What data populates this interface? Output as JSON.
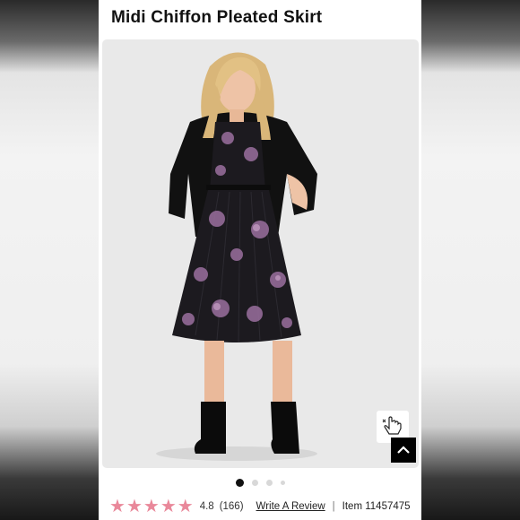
{
  "product": {
    "title": "Midi Chiffon Pleated Skirt"
  },
  "gallery": {
    "image_count": 4,
    "active_index": 0
  },
  "rating": {
    "stars": 5,
    "value": "4.8",
    "count": "(166)",
    "write_review": "Write A Review",
    "separator": "|",
    "item_number": "Item 11457475"
  },
  "colors": {
    "star": "#e9889a",
    "dress": "#1c1a1f",
    "floral": "#9a6f9e"
  },
  "icons": {
    "hand": "hand-pointer-icon",
    "scroll_up": "chevron-up-icon"
  }
}
